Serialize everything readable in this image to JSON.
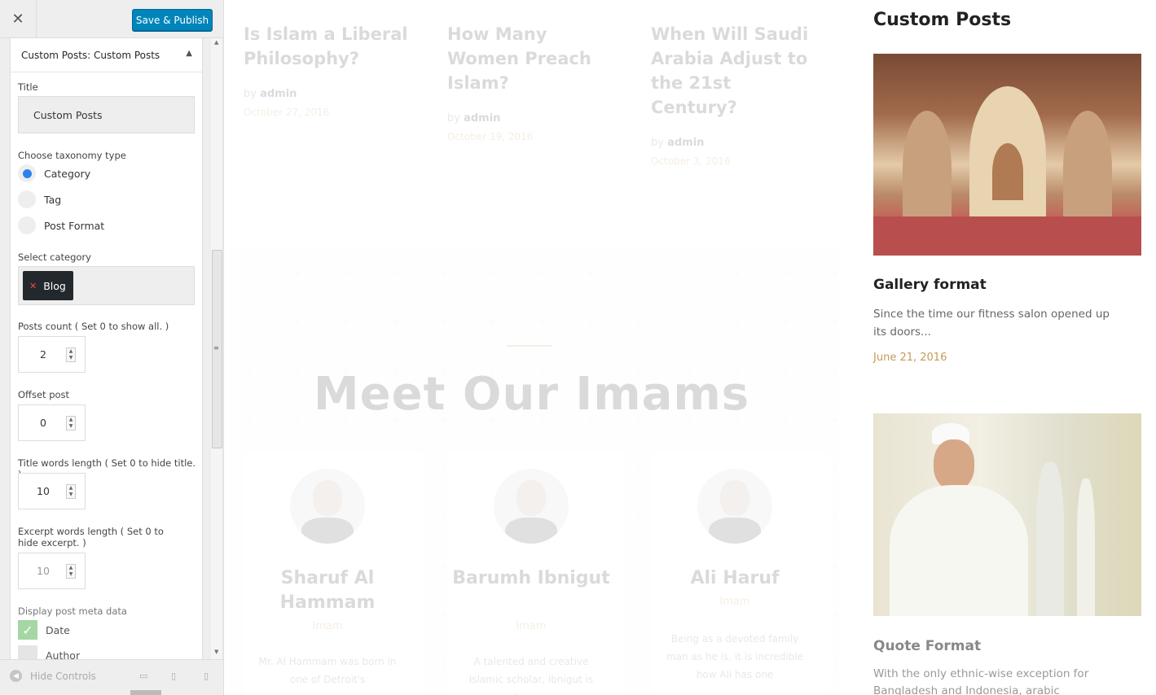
{
  "header": {
    "close_symbol": "✕",
    "save_label": "Save & Publish"
  },
  "section": {
    "prefix": "Custom Posts:",
    "name": "Custom Posts",
    "toggle_icon": "caret-up-icon"
  },
  "form": {
    "title_label": "Title",
    "title_value": "Custom Posts",
    "taxonomy_label": "Choose taxonomy type",
    "taxonomy_options": [
      "Category",
      "Tag",
      "Post Format"
    ],
    "taxonomy_selected": "Category",
    "select_category_label": "Select category",
    "selected_category": "Blog",
    "posts_count_label": "Posts count ( Set 0 to show all. )",
    "posts_count": "2",
    "offset_label": "Offset post",
    "offset": "0",
    "title_words_label": "Title words length ( Set 0 to hide title. )",
    "title_words": "10",
    "excerpt_words_label": "Excerpt words length ( Set 0 to hide excerpt. )",
    "excerpt_words": "10",
    "meta_label": "Display post meta data",
    "meta_options": [
      "Date",
      "Author"
    ]
  },
  "footer": {
    "hide_controls": "Hide Controls",
    "devices": [
      "desktop-icon",
      "tablet-icon",
      "mobile-icon"
    ]
  },
  "preview": {
    "posts": [
      {
        "title": "Is Islam a Liberal Philosophy?",
        "by": "by",
        "author": "admin",
        "date": "October 27, 2016"
      },
      {
        "title": "How Many Women Preach Islam?",
        "by": "by",
        "author": "admin",
        "date": "October 19, 2016"
      },
      {
        "title": "When Will Saudi Arabia Adjust to the 21st Century?",
        "by": "by",
        "author": "admin",
        "date": "October 3, 2016"
      }
    ],
    "section_title": "Meet Our Imams",
    "imams": [
      {
        "name": "Sharuf Al Hammam",
        "role": "Imam",
        "bio": "Mr. Al Hammam was born in one of Detroit's"
      },
      {
        "name": "Barumh Ibnigut",
        "role": "Imam",
        "bio": "A talented and creative Islamic scholar, Ibnigut is known"
      },
      {
        "name": "Ali Haruf",
        "role": "Imam",
        "bio": "Being as a devoted family man as he is, it is incredible how Ali has one"
      }
    ]
  },
  "widget": {
    "title": "Custom Posts",
    "posts": [
      {
        "title": "Gallery format",
        "excerpt": "Since the time our fitness salon opened up its doors...",
        "date": "June 21, 2016"
      },
      {
        "title": "Quote Format",
        "excerpt": "With the only ethnic-wise exception for Bangladesh and Indonesia, arabic"
      }
    ]
  },
  "colors": {
    "primary_button": "#0085ba",
    "accent": "#c49a58",
    "radio_on": "#2f80ed",
    "checkbox_on": "#a4d7a4"
  }
}
